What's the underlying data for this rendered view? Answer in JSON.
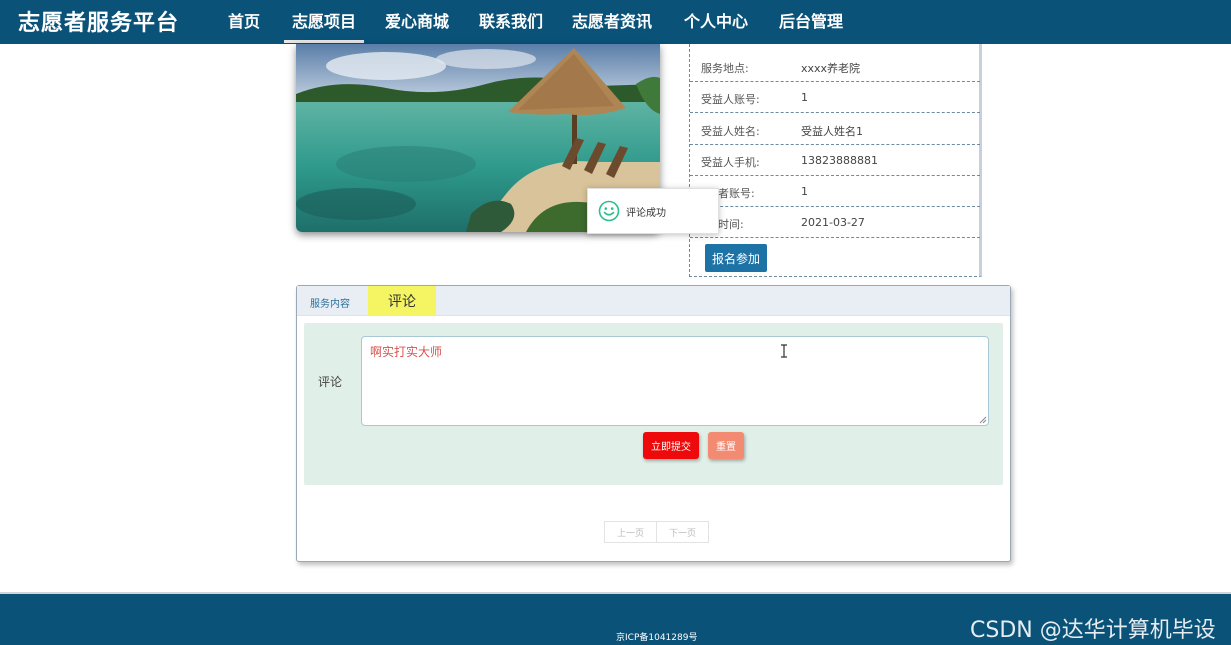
{
  "header": {
    "brand": "志愿者服务平台",
    "nav": [
      {
        "label": "首页"
      },
      {
        "label": "志愿项目"
      },
      {
        "label": "爱心商城"
      },
      {
        "label": "联系我们"
      },
      {
        "label": "志愿者资讯"
      },
      {
        "label": "个人中心"
      },
      {
        "label": "后台管理"
      }
    ],
    "active_nav": "志愿项目"
  },
  "toast": {
    "icon": "smile-icon",
    "message": "评论成功"
  },
  "details": {
    "rows": [
      {
        "label": "服务地点:",
        "value": "xxxx养老院"
      },
      {
        "label": "受益人账号:",
        "value": "1"
      },
      {
        "label": "受益人姓名:",
        "value": "受益人姓名1"
      },
      {
        "label": "受益人手机:",
        "value": "13823888881"
      },
      {
        "label": "者账号:",
        "value": "1"
      },
      {
        "label": "时间:",
        "value": "2021-03-27"
      }
    ],
    "signup_label": "报名参加"
  },
  "tabs": {
    "service_label": "服务内容",
    "comment_label": "评论"
  },
  "comment_form": {
    "label": "评论",
    "value": "啊实打实大师",
    "submit_label": "立即提交",
    "reset_label": "重置"
  },
  "pagination": {
    "prev_label": "上一页",
    "next_label": "下一页"
  },
  "footer": {
    "icp": "京ICP备1041289号",
    "watermark": "CSDN @达华计算机毕设"
  },
  "colors": {
    "nav_bg": "#0a5278",
    "signup_btn": "#1e73a6",
    "submit_btn": "#ee0a0a",
    "reset_btn": "#f38b73",
    "active_tab": "#f5f564",
    "form_bg": "#e0efe8"
  }
}
